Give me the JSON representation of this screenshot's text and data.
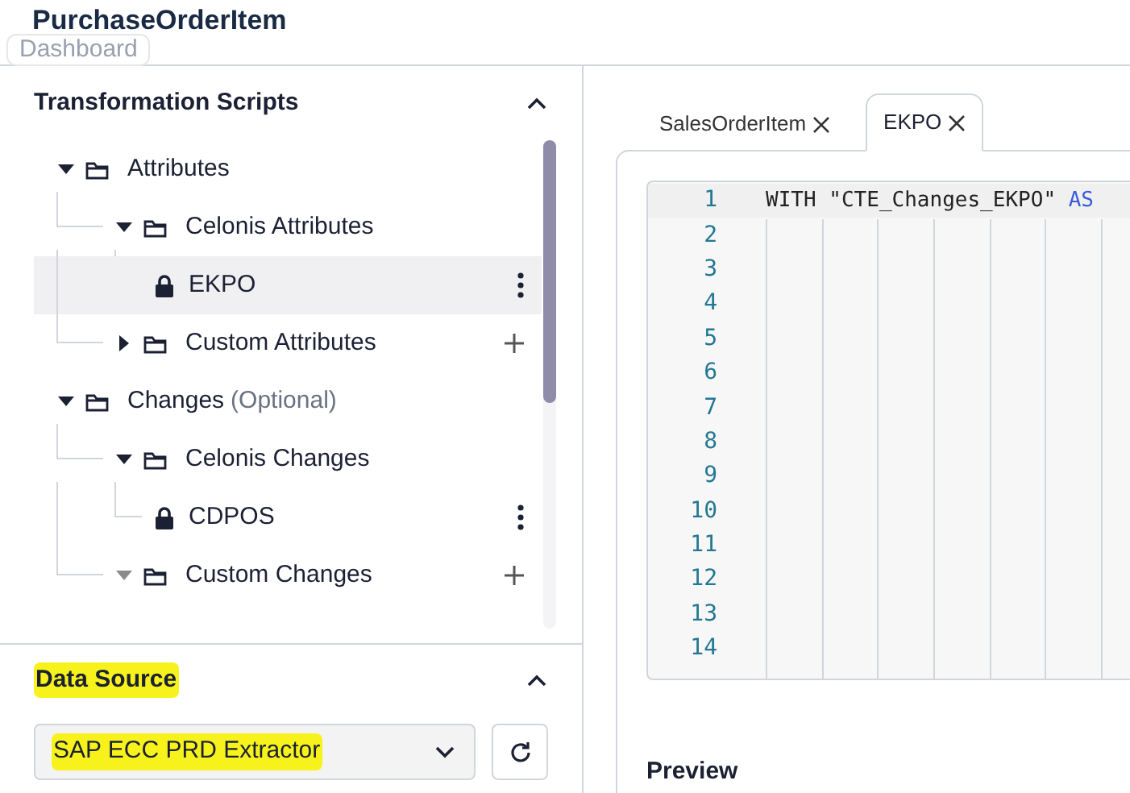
{
  "header": {
    "title": "PurchaseOrderItem",
    "tooltip": "Dashboard"
  },
  "transformation_scripts": {
    "title": "Transformation Scripts",
    "expanded": true,
    "tree": [
      {
        "label": "Attributes",
        "kind": "folder",
        "expanded": true,
        "children": [
          {
            "label": "Celonis Attributes",
            "kind": "folder",
            "expanded": true,
            "children": [
              {
                "label": "EKPO",
                "kind": "table",
                "selected": true,
                "menu": true
              }
            ]
          },
          {
            "label": "Custom Attributes",
            "kind": "folder",
            "expanded": false,
            "add_button": true
          }
        ]
      },
      {
        "label": "Changes",
        "suffix": "(Optional)",
        "kind": "folder",
        "expanded": true,
        "children": [
          {
            "label": "Celonis Changes",
            "kind": "folder",
            "expanded": true,
            "children": [
              {
                "label": "CDPOS",
                "kind": "table",
                "selected": false,
                "menu": true
              }
            ]
          },
          {
            "label": "Custom Changes",
            "kind": "folder",
            "expanded": true,
            "empty": true,
            "add_button": true
          }
        ]
      }
    ]
  },
  "data_source": {
    "title": "Data Source",
    "title_highlighted": true,
    "expanded": true,
    "value": "SAP ECC PRD Extractor",
    "value_highlighted": true
  },
  "tabs": [
    {
      "label": "SalesOrderItem",
      "selected": false
    },
    {
      "label": "EKPO",
      "selected": true
    }
  ],
  "editor": {
    "lines": [
      {
        "number": "1",
        "code": [
          {
            "text": "WITH",
            "kind": "plain"
          },
          {
            "text": " \"CTE_Changes_EKPO\" ",
            "kind": "plain"
          },
          {
            "text": "AS",
            "kind": "keyword"
          }
        ]
      },
      {
        "number": "2"
      },
      {
        "number": "3"
      },
      {
        "number": "4"
      },
      {
        "number": "5"
      },
      {
        "number": "6"
      },
      {
        "number": "7"
      },
      {
        "number": "8"
      },
      {
        "number": "9"
      },
      {
        "number": "10"
      },
      {
        "number": "11"
      },
      {
        "number": "12"
      },
      {
        "number": "13"
      },
      {
        "number": "14"
      }
    ]
  },
  "preview": {
    "title": "Preview"
  }
}
